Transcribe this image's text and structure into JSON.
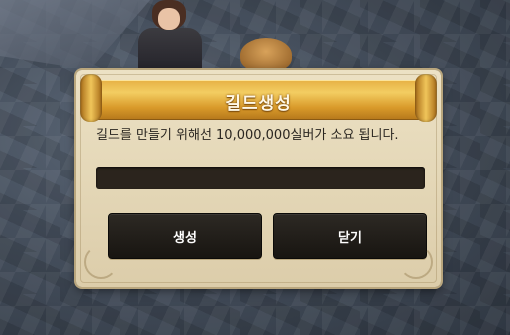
{
  "dialog": {
    "title": "길드생성",
    "message": "길드를 만들기 위해선 10,000,000실버가 소요 됩니다.",
    "create_label": "생성",
    "close_label": "닫기"
  },
  "colors": {
    "banner_gold": "#e7b347",
    "parchment": "#ece1c4",
    "button_dark": "#2d2924",
    "input_dark": "#2b241d"
  }
}
